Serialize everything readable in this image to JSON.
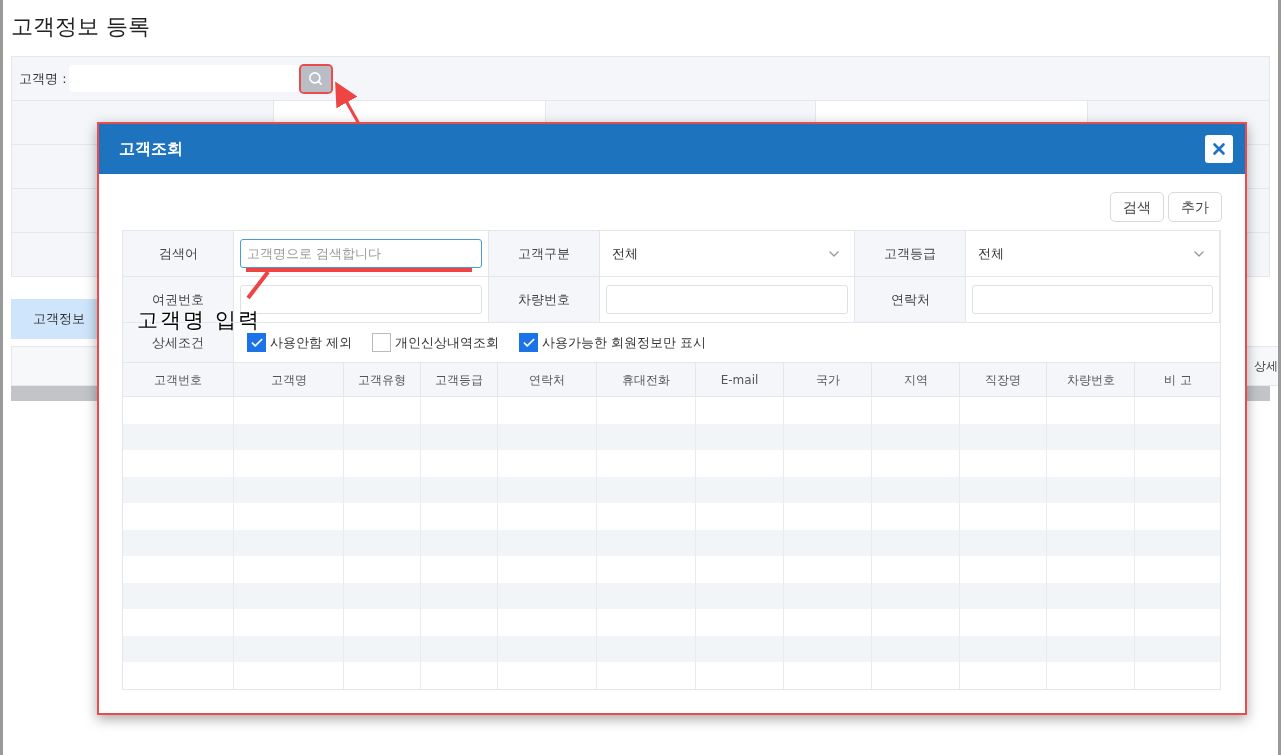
{
  "page": {
    "title": "고객정보 등록",
    "search_label": "고객명 :",
    "tab_label": "고객정보",
    "right_label": "상세"
  },
  "dialog": {
    "title": "고객조회",
    "buttons": [
      "검색",
      "추가"
    ],
    "form": [
      {
        "label": "검색어",
        "kind": "input",
        "placeholder": "고객명으로 검색합니다",
        "focused": true
      },
      {
        "label": "고객구분",
        "kind": "select",
        "value": "전체"
      },
      {
        "label": "고객등급",
        "kind": "select",
        "value": "전체"
      },
      {
        "label": "여권번호",
        "kind": "input",
        "focused": false
      },
      {
        "label": "차량번호",
        "kind": "input",
        "focused": false
      },
      {
        "label": "연락처",
        "kind": "input",
        "focused": false
      }
    ],
    "conditions_label": "상세조건",
    "conditions": [
      {
        "label": "사용안함 제외",
        "checked": true
      },
      {
        "label": "개인신상내역조회",
        "checked": false
      },
      {
        "label": "사용가능한 회원정보만 표시",
        "checked": true
      }
    ],
    "table": {
      "columns": [
        "고객번호",
        "고객명",
        "고객유형",
        "고객등급",
        "연락처",
        "휴대전화",
        "E-mail",
        "국가",
        "지역",
        "직장명",
        "차량번호",
        "비 고"
      ]
    }
  },
  "annotation": {
    "text": "고객명 입력"
  }
}
